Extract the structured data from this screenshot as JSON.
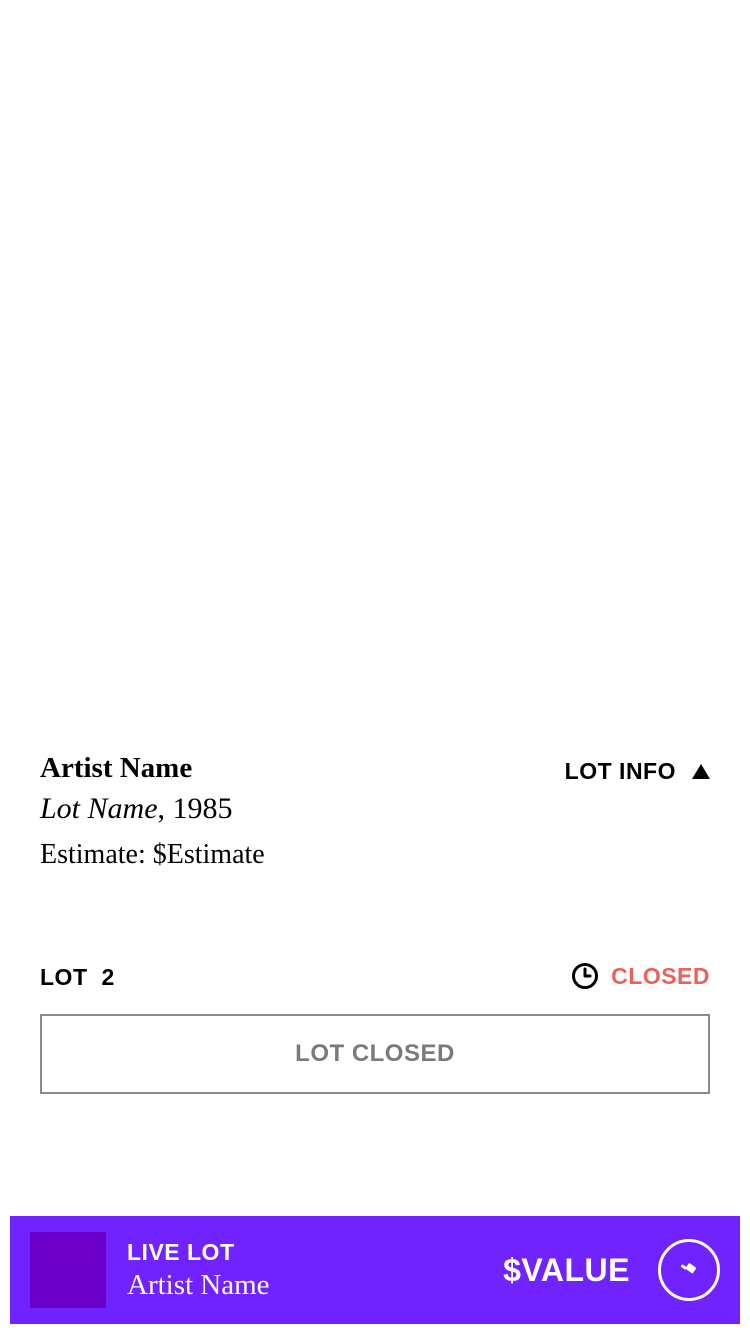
{
  "lot": {
    "artist_name": "Artist Name",
    "lot_name": "Lot Name",
    "year_separator": ", ",
    "year": "1985",
    "estimate_text": "Estimate: $Estimate",
    "info_toggle_label": "LOT INFO",
    "number_label": "LOT",
    "number_value": "2",
    "status_text": "CLOSED",
    "closed_button_label": "LOT CLOSED"
  },
  "live_lot": {
    "label": "LIVE LOT",
    "artist_name": "Artist Name",
    "value": "$VALUE"
  },
  "icons": {
    "info_toggle": "triangle-up-icon",
    "status": "clock-icon",
    "bid": "gavel-icon"
  },
  "colors": {
    "status_closed": "#e8645a",
    "live_bar_background": "#7023ff",
    "live_thumb": "#6a00c8",
    "closed_button_text": "#7a7a7a"
  }
}
